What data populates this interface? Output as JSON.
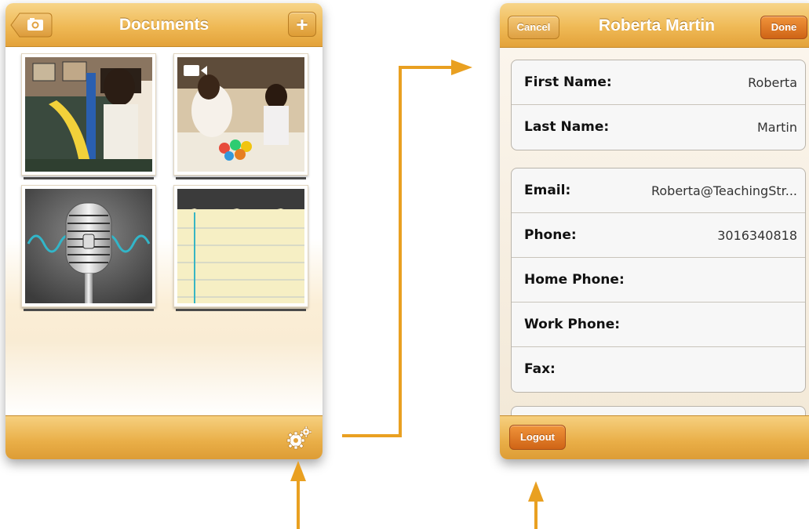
{
  "left_screen": {
    "title": "Documents",
    "plus_label": "+",
    "thumbnails": [
      {
        "kind": "photo",
        "icon": "photo-icon"
      },
      {
        "kind": "video",
        "icon": "video-camera-icon"
      },
      {
        "kind": "audio",
        "icon": "microphone-icon"
      },
      {
        "kind": "note",
        "icon": "notepad-icon"
      }
    ],
    "toolbar_icon": "gears-icon"
  },
  "right_screen": {
    "title": "Roberta Martin",
    "cancel_label": "Cancel",
    "done_label": "Done",
    "name_fields": [
      {
        "label": "First Name:",
        "value": "Roberta"
      },
      {
        "label": "Last Name:",
        "value": "Martin"
      }
    ],
    "contact_fields": [
      {
        "label": "Email:",
        "value": "Roberta@TeachingStr..."
      },
      {
        "label": "Phone:",
        "value": "3016340818"
      },
      {
        "label": "Home Phone:",
        "value": ""
      },
      {
        "label": "Work Phone:",
        "value": ""
      },
      {
        "label": "Fax:",
        "value": ""
      }
    ],
    "logout_label": "Logout"
  },
  "colors": {
    "nav_orange": "#efb955",
    "done_orange": "#d96c1c",
    "arrow": "#e9a021"
  }
}
